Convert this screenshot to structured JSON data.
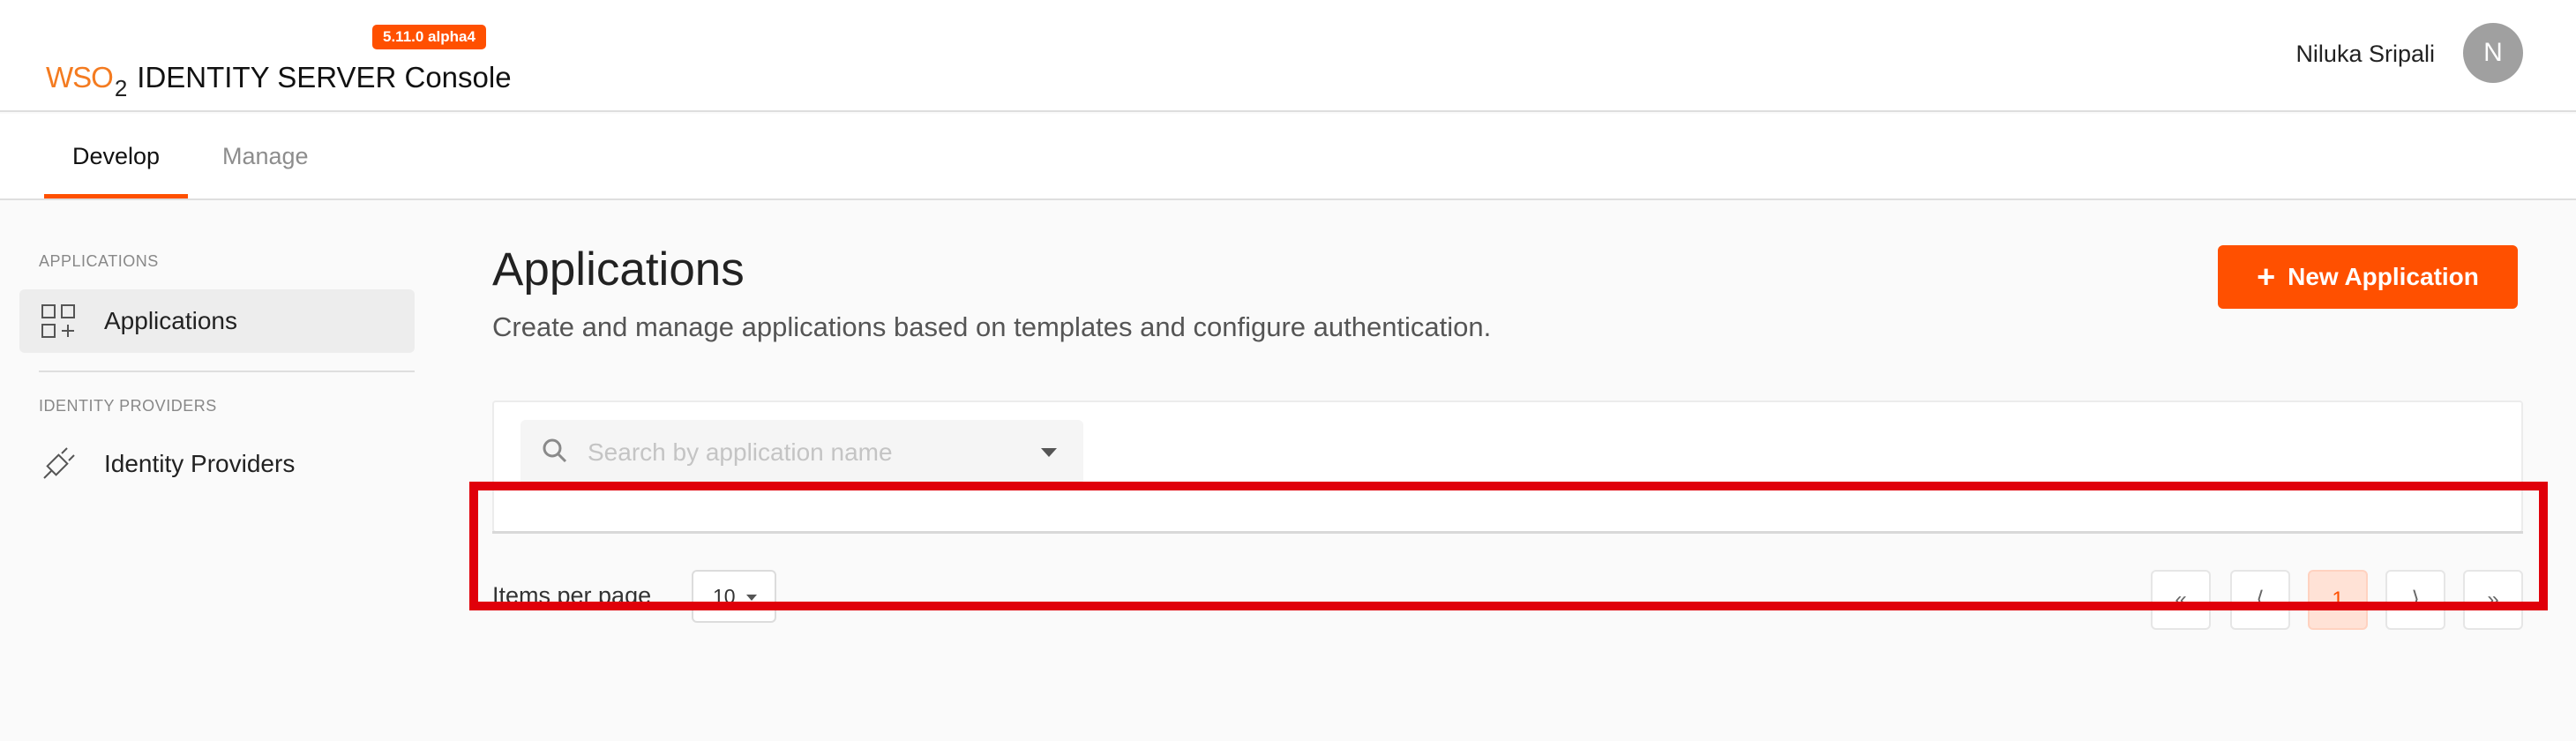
{
  "header": {
    "logo_wso": "WSO",
    "logo_sub": "2",
    "product_title": "IDENTITY SERVER",
    "product_suffix": "Console",
    "version": "5.11.0 alpha4",
    "user_name": "Niluka Sripali",
    "avatar_initial": "N"
  },
  "tabs": [
    {
      "label": "Develop",
      "active": true
    },
    {
      "label": "Manage",
      "active": false
    }
  ],
  "sidebar": {
    "sections": [
      {
        "title": "APPLICATIONS",
        "items": [
          {
            "label": "Applications",
            "icon": "apps-add-icon",
            "active": true
          }
        ]
      },
      {
        "title": "IDENTITY PROVIDERS",
        "items": [
          {
            "label": "Identity Providers",
            "icon": "plug-icon",
            "active": false
          }
        ]
      }
    ]
  },
  "main": {
    "title": "Applications",
    "subtitle": "Create and manage applications based on templates and configure authentication.",
    "new_button_label": "New Application",
    "search_placeholder": "Search by application name",
    "items_per_page_label": "Items per page",
    "items_per_page_value": "10"
  },
  "pagination": {
    "first": "«",
    "prev": "⟨",
    "current": "1",
    "next": "⟩",
    "last": "»"
  },
  "colors": {
    "accent": "#ff5000",
    "highlight": "#e0000a"
  }
}
